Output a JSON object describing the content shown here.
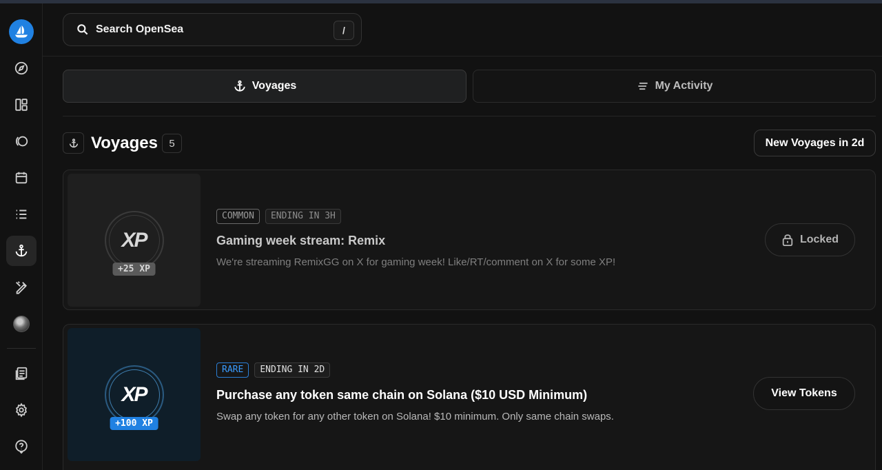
{
  "search": {
    "label": "Search OpenSea",
    "shortcut": "/"
  },
  "tabs": [
    {
      "label": "Voyages",
      "icon": "anchor-icon",
      "active": true
    },
    {
      "label": "My Activity",
      "icon": "lines-icon",
      "active": false
    }
  ],
  "section": {
    "title": "Voyages",
    "count": "5",
    "new_button": "New Voyages in 2d"
  },
  "sidebar": {
    "items": [
      {
        "name": "compass-icon"
      },
      {
        "name": "dashboard-icon"
      },
      {
        "name": "drops-icon"
      },
      {
        "name": "calendar-icon"
      },
      {
        "name": "list-icon"
      },
      {
        "name": "anchor-icon",
        "active": true
      },
      {
        "name": "studio-icon"
      },
      {
        "name": "avatar"
      },
      {
        "name": "docs-icon"
      },
      {
        "name": "settings-icon"
      },
      {
        "name": "help-icon"
      }
    ]
  },
  "voyages": [
    {
      "rarity": "COMMON",
      "ending": "ENDING IN 3H",
      "title": "Gaming week stream: Remix",
      "description": "We're streaming RemixGG on X for gaming week! Like/RT/comment on X for some XP!",
      "xp_logo": "XP",
      "xp": "+25 XP",
      "action": "Locked"
    },
    {
      "rarity": "RARE",
      "ending": "ENDING IN 2D",
      "title": "Purchase any token same chain on Solana ($10 USD Minimum)",
      "description": "Swap any token for any other token on Solana! $10 minimum. Only same chain swaps.",
      "xp_logo": "XP",
      "xp": "+100 XP",
      "action": "View Tokens"
    }
  ],
  "colors": {
    "accent": "#2081e2",
    "background": "#121212",
    "rare": "#3a9cff"
  }
}
